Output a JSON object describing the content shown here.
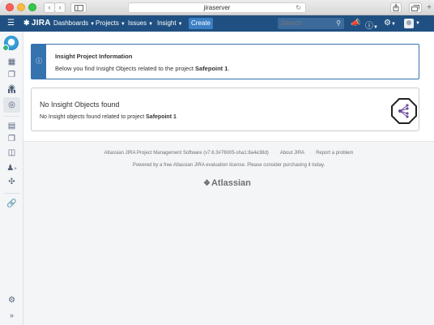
{
  "browser": {
    "url": "jiraserver",
    "back_glyph": "‹",
    "forward_glyph": "›",
    "newtab_glyph": "+"
  },
  "header": {
    "logo_text": "JIRA",
    "nav": [
      {
        "label": "Dashboards"
      },
      {
        "label": "Projects"
      },
      {
        "label": "Issues"
      },
      {
        "label": "Insight"
      }
    ],
    "create_label": "Create",
    "search_placeholder": "Search",
    "colors": {
      "bar": "#205081",
      "create": "#3b7fc4"
    }
  },
  "sidebar": {
    "icons": [
      "board-icon",
      "releases-icon",
      "components-icon",
      "reports-icon",
      "insight-icon",
      "issues-icon",
      "versions-icon",
      "feedback-icon",
      "add-user-icon",
      "compass-icon",
      "link-icon",
      "settings-icon",
      "expand-icon"
    ],
    "expand_glyph": "»"
  },
  "info": {
    "title": "Insight Project Information",
    "text_prefix": "Below you find Insight Objects related to the project ",
    "project": "Safepoint 1",
    "text_suffix": "."
  },
  "empty": {
    "title": "No Insight Objects found",
    "text_prefix": "No Insight objects found related to project ",
    "project": "Safepoint 1"
  },
  "footer": {
    "software": "Atlassian JIRA Project Management Software (v7.6.3#76005-sha1:8a4e38d)",
    "about": "About JIRA",
    "report": "Report a problem",
    "license": "Powered by a free Atlassian JIRA evaluation license. Please consider purchasing it today.",
    "brand": "Atlassian"
  }
}
